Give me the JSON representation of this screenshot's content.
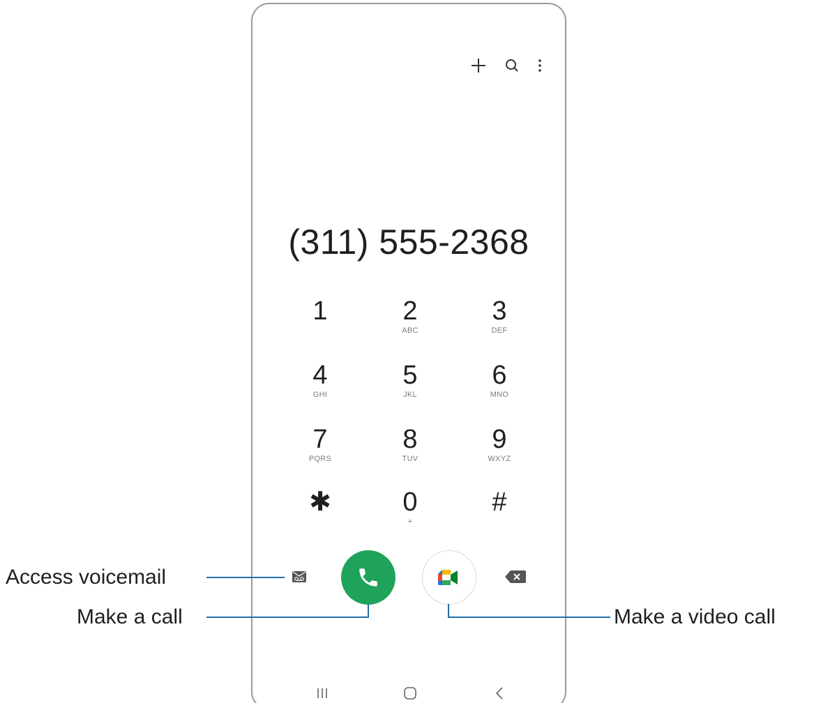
{
  "top_actions": [
    {
      "name": "add-icon",
      "label": "+"
    },
    {
      "name": "search-icon"
    },
    {
      "name": "more-options-icon"
    }
  ],
  "display": {
    "number": "(311) 555-2368"
  },
  "keypad": [
    {
      "digit": "1",
      "letters": ""
    },
    {
      "digit": "2",
      "letters": "ABC"
    },
    {
      "digit": "3",
      "letters": "DEF"
    },
    {
      "digit": "4",
      "letters": "GHI"
    },
    {
      "digit": "5",
      "letters": "JKL"
    },
    {
      "digit": "6",
      "letters": "MNO"
    },
    {
      "digit": "7",
      "letters": "PQRS"
    },
    {
      "digit": "8",
      "letters": "TUV"
    },
    {
      "digit": "9",
      "letters": "WXYZ"
    },
    {
      "digit": "✱",
      "letters": ""
    },
    {
      "digit": "0",
      "letters": "+"
    },
    {
      "digit": "#",
      "letters": ""
    }
  ],
  "actions": {
    "voicemail_icon": "voicemail-icon",
    "call_icon": "phone-icon",
    "video_icon": "google-meet-icon",
    "backspace_icon": "backspace-icon"
  },
  "callouts": {
    "voicemail": "Access voicemail",
    "call": "Make a call",
    "video_call": "Make a video call"
  },
  "colors": {
    "call_green": "#1fa35a",
    "callout_line": "#1f6fa8"
  },
  "nav_bar": [
    "recent-apps-icon",
    "home-icon",
    "back-icon"
  ]
}
